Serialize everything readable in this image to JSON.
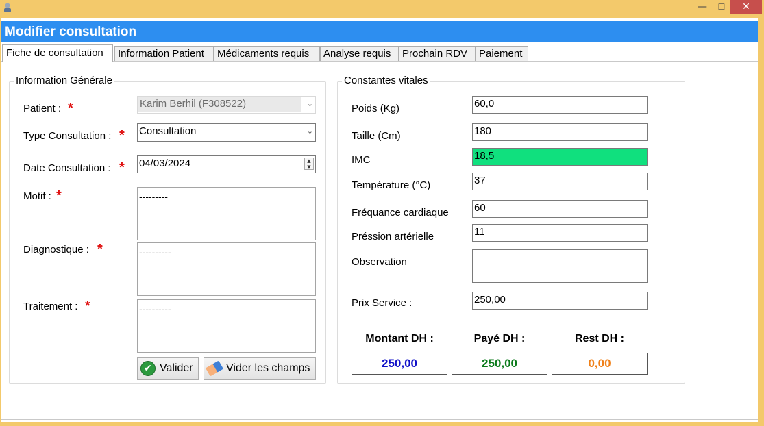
{
  "window": {
    "title": "Modifier consultation",
    "colors": {
      "header": "#2d8ef0",
      "frame": "#f3c96b",
      "close": "#c74f4c"
    }
  },
  "tabs": [
    "Fiche de consultation",
    "Information Patient",
    "Médicaments requis",
    "Analyse requis",
    "Prochain RDV",
    "Paiement"
  ],
  "general": {
    "legend": "Information Générale",
    "patient_label": "Patient :",
    "patient_value": "Karim Berhil (F308522)",
    "type_label": "Type Consultation :",
    "type_value": "Consultation",
    "date_label": "Date Consultation :",
    "date_value": "04/03/2024",
    "motif_label": "Motif :",
    "motif_value": "---------",
    "diagnostique_label": "Diagnostique :",
    "diagnostique_value": "----------",
    "traitement_label": "Traitement :",
    "traitement_value": "----------",
    "required_mark": "*",
    "valider_label": "Valider",
    "vider_label": "Vider les champs"
  },
  "vitals": {
    "legend": "Constantes vitales",
    "poids_label": "Poids (Kg)",
    "poids_value": "60,0",
    "taille_label": "Taille (Cm)",
    "taille_value": "180",
    "imc_label": "IMC",
    "imc_value": "18,5",
    "imc_color": "#10e07e",
    "temp_label": "Température (°C)",
    "temp_value": "37",
    "freq_label": "Fréquance cardiaque",
    "freq_value": "60",
    "pression_label": "Préssion artérielle",
    "pression_value": "11",
    "observation_label": "Observation",
    "observation_value": "",
    "prix_label": "Prix Service  :",
    "prix_value": "250,00"
  },
  "summary": {
    "montant_label": "Montant DH :",
    "montant_value": "250,00",
    "montant_color": "#1010c8",
    "paye_label": "Payé DH :",
    "paye_value": "250,00",
    "paye_color": "#0a7a1a",
    "rest_label": "Rest DH :",
    "rest_value": "0,00",
    "rest_color": "#f08018"
  }
}
